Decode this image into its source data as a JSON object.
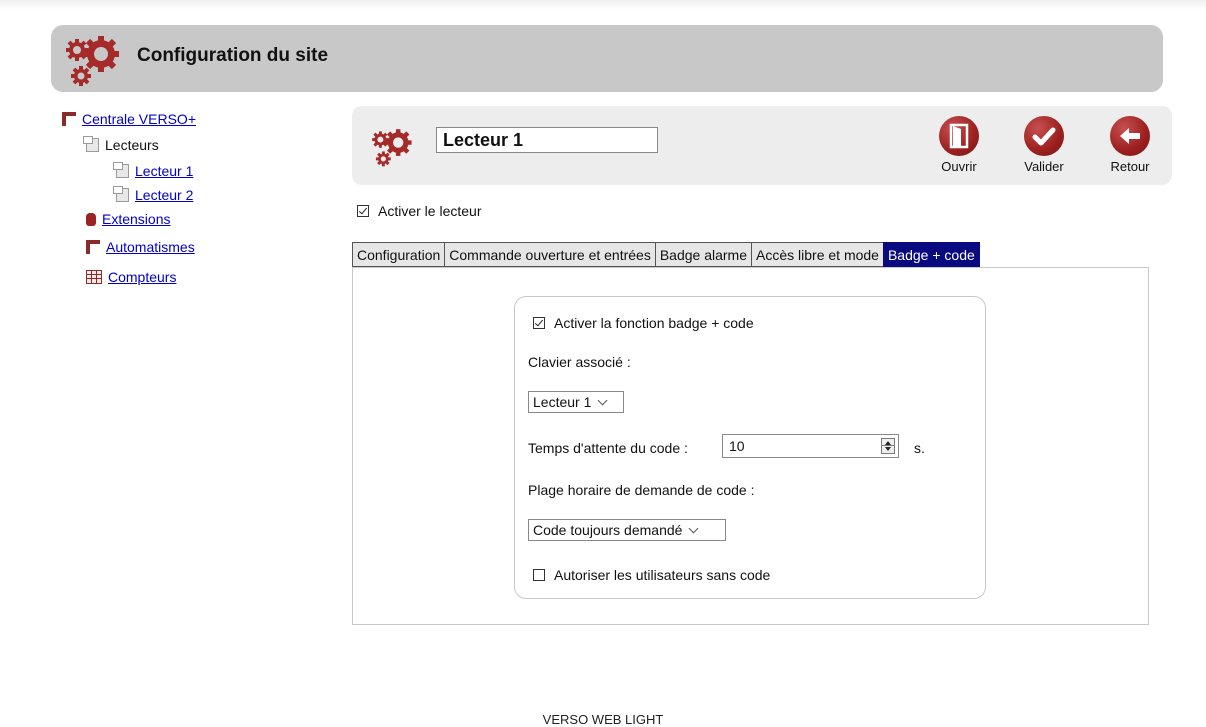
{
  "header": {
    "title": "Configuration du site",
    "icon": "gears-icon"
  },
  "sidebar": {
    "root": "Centrale VERSO+",
    "lecteurs": "Lecteurs",
    "lecteur1": "Lecteur 1",
    "lecteur2": "Lecteur 2",
    "extensions": "Extensions",
    "automatismes": "Automatismes",
    "compteurs": "Compteurs"
  },
  "reader": {
    "name_value": "Lecteur 1",
    "buttons": {
      "open": "Ouvrir",
      "validate": "Valider",
      "back": "Retour"
    },
    "enable_label": "Activer le lecteur",
    "enable_checked": true
  },
  "tabs": [
    {
      "label": "Configuration",
      "active": false
    },
    {
      "label": "Commande ouverture et entrées",
      "active": false
    },
    {
      "label": "Badge alarme",
      "active": false
    },
    {
      "label": "Accès libre et mode",
      "active": false
    },
    {
      "label": "Badge + code",
      "active": true
    }
  ],
  "badge_code": {
    "enable_label": "Activer la fonction badge + code",
    "enable_checked": true,
    "keypad_label": "Clavier associé :",
    "keypad_selected": "Lecteur 1",
    "wait_label": "Temps d'attente du code :",
    "wait_value": "10",
    "wait_unit": "s.",
    "schedule_label": "Plage horaire de demande de code :",
    "schedule_selected": "Code toujours demandé",
    "no_code_label": "Autoriser les utilisateurs sans code",
    "no_code_checked": false
  },
  "footer": {
    "text": "VERSO WEB LIGHT"
  },
  "colors": {
    "accent_red": "#9b1f1f",
    "active_tab": "#0a0a80",
    "header_bg": "#c8c8c8"
  }
}
